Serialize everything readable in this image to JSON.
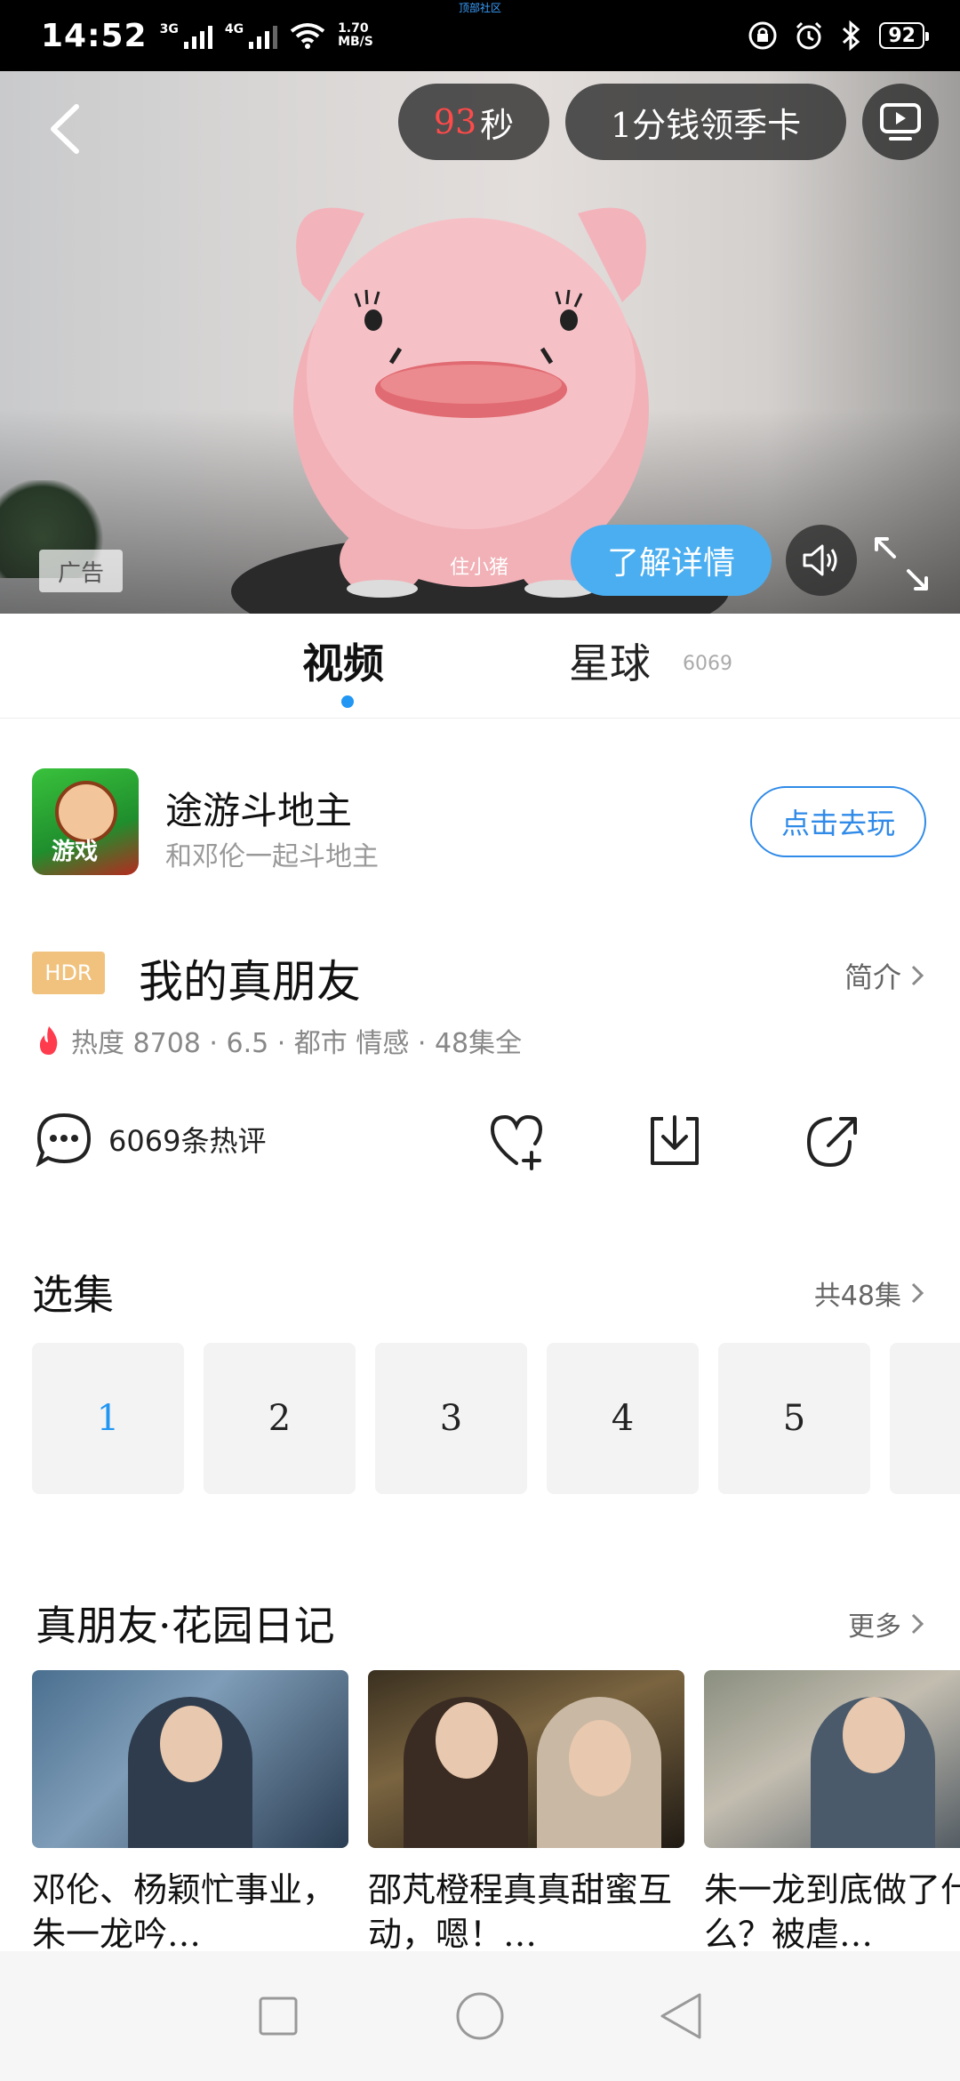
{
  "status_bar": {
    "time": "14:52",
    "signal1_label": "3G",
    "signal2_label": "4G",
    "net_speed_value": "1.70",
    "net_speed_unit": "MB/S",
    "battery": "92",
    "notch_label": "顶部社区"
  },
  "video": {
    "timer_number": "93",
    "timer_unit": "秒",
    "promo_text": "1分钱领季卡",
    "ad_label": "广告",
    "watermark": "住小猪",
    "learn_more": "了解详情"
  },
  "tabs": {
    "video": "视频",
    "planet": "星球",
    "planet_count": "6069"
  },
  "game_ad": {
    "icon_tag": "游戏",
    "title": "途游斗地主",
    "subtitle": "和邓伦一起斗地主",
    "play_button": "点击去玩"
  },
  "show": {
    "badge": "HDR",
    "title": "我的真朋友",
    "intro_link": "简介",
    "meta": "热度 8708 · 6.5 · 都市 情感 · 48集全",
    "comments": "6069条热评"
  },
  "episodes": {
    "title": "选集",
    "total": "共48集",
    "items": [
      "1",
      "2",
      "3",
      "4",
      "5"
    ]
  },
  "collection": {
    "title": "真朋友·花园日记",
    "more": "更多",
    "cards": [
      {
        "caption": "邓伦、杨颖忙事业，朱一龙吟…"
      },
      {
        "caption": "邵芃橙程真真甜蜜互动，嗯！…"
      },
      {
        "caption": "朱一龙到底做了什么？被虐…"
      }
    ]
  },
  "colors": {
    "accent": "#2196f3",
    "learn_button": "#4aaef0",
    "hdr_badge": "#f1c27d",
    "timer_number": "#ff4a4a",
    "flame": "#ff3b4e"
  }
}
